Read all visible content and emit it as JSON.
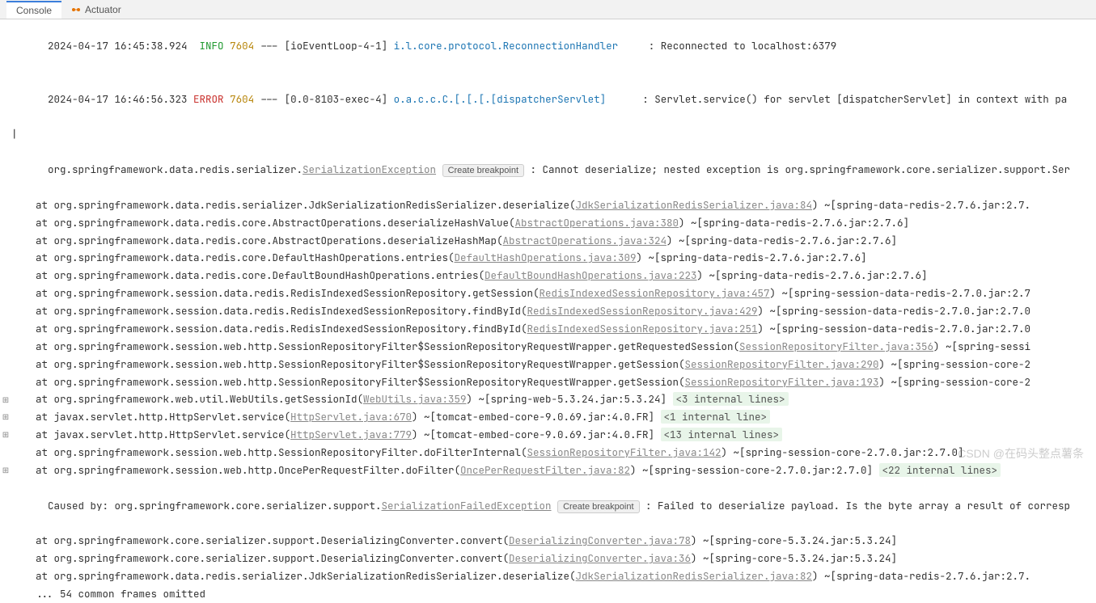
{
  "tabs": {
    "console": "Console",
    "actuator": "Actuator"
  },
  "log": {
    "line1": {
      "timestamp": "2024-04-17 16:45:38.924",
      "level": "INFO",
      "pid": "7604",
      "sep": "---",
      "thread": "[ioEventLoop-4-1]",
      "logger": "i.l.core.protocol.ReconnectionHandler",
      "message": ": Reconnected to localhost:6379"
    },
    "line2": {
      "timestamp": "2024-04-17 16:46:56.323",
      "level": "ERROR",
      "pid": "7604",
      "sep": "---",
      "thread": "[0.0-8103-exec-4]",
      "logger": "o.a.c.c.C.[.[.[.[dispatcherServlet]",
      "message": ": Servlet.service() for servlet [dispatcherServlet] in context with pa"
    }
  },
  "exception": {
    "prefix": "org.springframework.data.redis.serializer.",
    "class": "SerializationException",
    "breakpoint": "Create breakpoint",
    "message": ": Cannot deserialize; nested exception is org.springframework.core.serializer.support.Ser"
  },
  "stack": [
    {
      "txt1": "    at org.springframework.data.redis.serializer.JdkSerializationRedisSerializer.deserialize(",
      "link": "JdkSerializationRedisSerializer.java:84",
      "txt2": ") ~[spring-data-redis-2.7.6.jar:2.7."
    },
    {
      "txt1": "    at org.springframework.data.redis.core.AbstractOperations.deserializeHashValue(",
      "link": "AbstractOperations.java:380",
      "txt2": ") ~[spring-data-redis-2.7.6.jar:2.7.6]"
    },
    {
      "txt1": "    at org.springframework.data.redis.core.AbstractOperations.deserializeHashMap(",
      "link": "AbstractOperations.java:324",
      "txt2": ") ~[spring-data-redis-2.7.6.jar:2.7.6]"
    },
    {
      "txt1": "    at org.springframework.data.redis.core.DefaultHashOperations.entries(",
      "link": "DefaultHashOperations.java:309",
      "txt2": ") ~[spring-data-redis-2.7.6.jar:2.7.6]"
    },
    {
      "txt1": "    at org.springframework.data.redis.core.DefaultBoundHashOperations.entries(",
      "link": "DefaultBoundHashOperations.java:223",
      "txt2": ") ~[spring-data-redis-2.7.6.jar:2.7.6]"
    },
    {
      "txt1": "    at org.springframework.session.data.redis.RedisIndexedSessionRepository.getSession(",
      "link": "RedisIndexedSessionRepository.java:457",
      "txt2": ") ~[spring-session-data-redis-2.7.0.jar:2.7"
    },
    {
      "txt1": "    at org.springframework.session.data.redis.RedisIndexedSessionRepository.findById(",
      "link": "RedisIndexedSessionRepository.java:429",
      "txt2": ") ~[spring-session-data-redis-2.7.0.jar:2.7.0"
    },
    {
      "txt1": "    at org.springframework.session.data.redis.RedisIndexedSessionRepository.findById(",
      "link": "RedisIndexedSessionRepository.java:251",
      "txt2": ") ~[spring-session-data-redis-2.7.0.jar:2.7.0"
    },
    {
      "txt1": "    at org.springframework.session.web.http.SessionRepositoryFilter$SessionRepositoryRequestWrapper.getRequestedSession(",
      "link": "SessionRepositoryFilter.java:356",
      "txt2": ") ~[spring-sessi"
    },
    {
      "txt1": "    at org.springframework.session.web.http.SessionRepositoryFilter$SessionRepositoryRequestWrapper.getSession(",
      "link": "SessionRepositoryFilter.java:290",
      "txt2": ") ~[spring-session-core-2"
    },
    {
      "txt1": "    at org.springframework.session.web.http.SessionRepositoryFilter$SessionRepositoryRequestWrapper.getSession(",
      "link": "SessionRepositoryFilter.java:193",
      "txt2": ") ~[spring-session-core-2"
    },
    {
      "txt1": "    at org.springframework.web.util.WebUtils.getSessionId(",
      "link": "WebUtils.java:359",
      "txt2": ") ~[spring-web-5.3.24.jar:5.3.24] ",
      "fold": "<3 internal lines>",
      "expand": "⊞"
    },
    {
      "txt1": "    at javax.servlet.http.HttpServlet.service(",
      "link": "HttpServlet.java:670",
      "txt2": ") ~[tomcat-embed-core-9.0.69.jar:4.0.FR] ",
      "fold": "<1 internal line>",
      "expand": "⊞"
    },
    {
      "txt1": "    at javax.servlet.http.HttpServlet.service(",
      "link": "HttpServlet.java:779",
      "txt2": ") ~[tomcat-embed-core-9.0.69.jar:4.0.FR] ",
      "fold": "<13 internal lines>",
      "expand": "⊞"
    },
    {
      "txt1": "    at org.springframework.session.web.http.SessionRepositoryFilter.doFilterInternal(",
      "link": "SessionRepositoryFilter.java:142",
      "txt2": ") ~[spring-session-core-2.7.0.jar:2.7.0]"
    },
    {
      "txt1": "    at org.springframework.session.web.http.OncePerRequestFilter.doFilter(",
      "link": "OncePerRequestFilter.java:82",
      "txt2": ") ~[spring-session-core-2.7.0.jar:2.7.0] ",
      "fold": "<22 internal lines>",
      "expand": "⊞"
    }
  ],
  "caused": {
    "prefix": "Caused by: org.springframework.core.serializer.support.",
    "class": "SerializationFailedException",
    "breakpoint": "Create breakpoint",
    "message": ": Failed to deserialize payload. Is the byte array a result of corresp"
  },
  "stack2": [
    {
      "txt1": "    at org.springframework.core.serializer.support.DeserializingConverter.convert(",
      "link": "DeserializingConverter.java:78",
      "txt2": ") ~[spring-core-5.3.24.jar:5.3.24]"
    },
    {
      "txt1": "    at org.springframework.core.serializer.support.DeserializingConverter.convert(",
      "link": "DeserializingConverter.java:36",
      "txt2": ") ~[spring-core-5.3.24.jar:5.3.24]"
    },
    {
      "txt1": "    at org.springframework.data.redis.serializer.JdkSerializationRedisSerializer.deserialize(",
      "link": "JdkSerializationRedisSerializer.java:82",
      "txt2": ") ~[spring-data-redis-2.7.6.jar:2.7."
    }
  ],
  "omitted": "    ... 54 common frames omitted",
  "watermark": "CSDN @在码头整点薯条"
}
